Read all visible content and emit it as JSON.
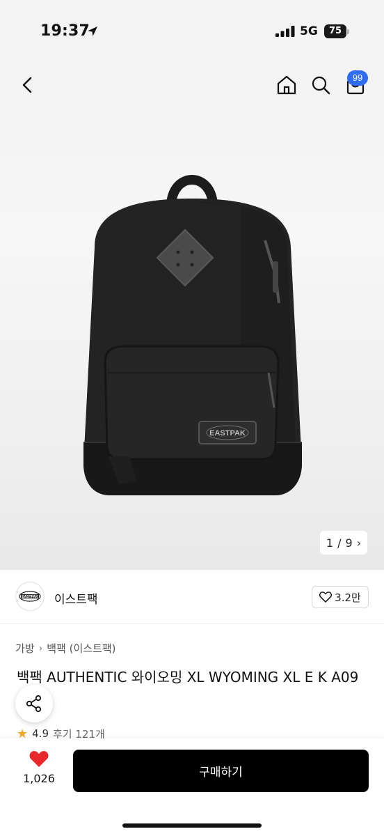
{
  "status": {
    "time": "19:37",
    "network": "5G",
    "battery": "75"
  },
  "nav": {
    "cart_badge": "99"
  },
  "gallery": {
    "current": "1",
    "total": "9",
    "separator": "/",
    "logo_text": "EASTPAK"
  },
  "brand": {
    "name": "이스트팩",
    "logo_text": "EASTPAK",
    "likes": "3.2만"
  },
  "breadcrumb": {
    "category": "가방",
    "subcategory": "백팩 (이스트팩)"
  },
  "product": {
    "title": "백팩 AUTHENTIC 와이오밍 XL WYOMING XL E K A09 7K9",
    "rating": "4.9",
    "reviews": "후기 121개"
  },
  "bottom": {
    "wish_count": "1,026",
    "buy_label": "구매하기"
  },
  "colors": {
    "badge": "#2f6cf0",
    "heart": "#e8282b",
    "buy_button": "#000000",
    "star": "#f3a626"
  }
}
